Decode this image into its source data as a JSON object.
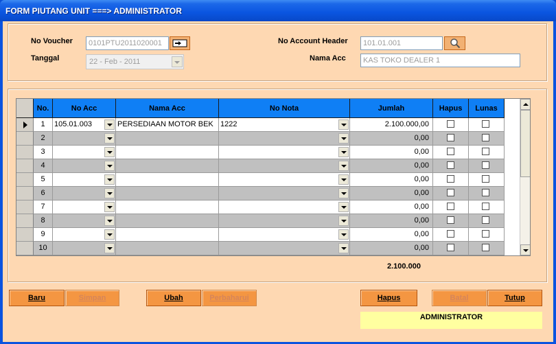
{
  "window": {
    "title": "FORM PIUTANG UNIT ===> ADMINISTRATOR"
  },
  "header": {
    "voucher_label": "No Voucher",
    "voucher_value": "0101PTU2011020001",
    "tanggal_label": "Tanggal",
    "tanggal_value": "22 -  Feb  - 2011",
    "account_header_label": "No Account Header",
    "account_header_value": "101.01.001",
    "nama_acc_label": "Nama Acc",
    "nama_acc_value": "KAS TOKO DEALER 1"
  },
  "grid": {
    "columns": [
      "No.",
      "No Acc",
      "Nama Acc",
      "No Nota",
      "Jumlah",
      "Hapus",
      "Lunas"
    ],
    "rows": [
      {
        "no": "1",
        "no_acc": "105.01.003",
        "nama_acc": "PERSEDIAAN MOTOR BEK",
        "no_nota": "1222",
        "jumlah": "2.100.000,00"
      },
      {
        "no": "2",
        "no_acc": "",
        "nama_acc": "",
        "no_nota": "",
        "jumlah": "0,00"
      },
      {
        "no": "3",
        "no_acc": "",
        "nama_acc": "",
        "no_nota": "",
        "jumlah": "0,00"
      },
      {
        "no": "4",
        "no_acc": "",
        "nama_acc": "",
        "no_nota": "",
        "jumlah": "0,00"
      },
      {
        "no": "5",
        "no_acc": "",
        "nama_acc": "",
        "no_nota": "",
        "jumlah": "0,00"
      },
      {
        "no": "6",
        "no_acc": "",
        "nama_acc": "",
        "no_nota": "",
        "jumlah": "0,00"
      },
      {
        "no": "7",
        "no_acc": "",
        "nama_acc": "",
        "no_nota": "",
        "jumlah": "0,00"
      },
      {
        "no": "8",
        "no_acc": "",
        "nama_acc": "",
        "no_nota": "",
        "jumlah": "0,00"
      },
      {
        "no": "9",
        "no_acc": "",
        "nama_acc": "",
        "no_nota": "",
        "jumlah": "0,00"
      },
      {
        "no": "10",
        "no_acc": "",
        "nama_acc": "",
        "no_nota": "",
        "jumlah": "0,00"
      }
    ],
    "total": "2.100.000"
  },
  "buttons": {
    "baru": "Baru",
    "simpan": "Simpan",
    "ubah": "Ubah",
    "perbaharui": "Perbaharui",
    "hapus": "Hapus",
    "batal": "Batal",
    "tutup": "Tutup"
  },
  "status": {
    "user": "ADMINISTRATOR"
  },
  "colors": {
    "title_bar": "#0a55e0",
    "form_bg": "#fed8b2",
    "grid_header": "#0f7ff5",
    "button": "#f49642",
    "status_bg": "#ffffa0"
  }
}
